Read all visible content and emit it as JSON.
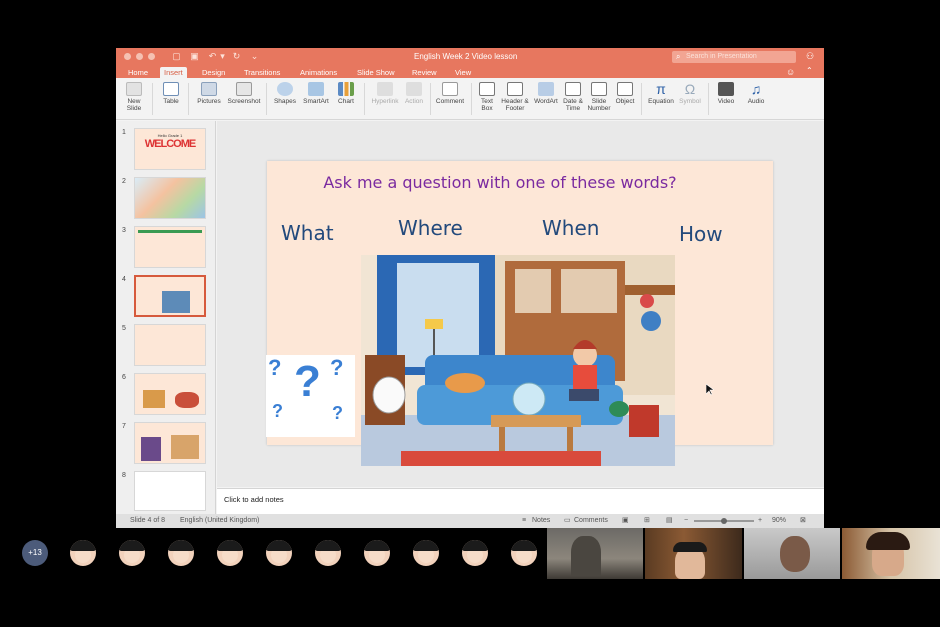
{
  "window": {
    "doc_title": "English Week 2 Video lesson",
    "search_placeholder": "Search in Presentation"
  },
  "tabs": [
    "Home",
    "Insert",
    "Design",
    "Transitions",
    "Animations",
    "Slide Show",
    "Review",
    "View"
  ],
  "active_tab": "Insert",
  "ribbon": {
    "new_slide": "New Slide",
    "table": "Table",
    "pictures": "Pictures",
    "screenshot": "Screenshot",
    "shapes": "Shapes",
    "smartart": "SmartArt",
    "chart": "Chart",
    "hyperlink": "Hyperlink",
    "action": "Action",
    "comment": "Comment",
    "text_box": "Text Box",
    "header_footer": "Header & Footer",
    "wordart": "WordArt",
    "date_time": "Date & Time",
    "slide_number": "Slide Number",
    "object": "Object",
    "equation": "Equation",
    "symbol": "Symbol",
    "video": "Video",
    "audio": "Audio"
  },
  "slide_numbers": [
    "1",
    "2",
    "3",
    "4",
    "5",
    "6",
    "7",
    "8"
  ],
  "selected_slide": 4,
  "thumb1_title": "Hello Grade 1",
  "thumb1_welcome": "WELCOME",
  "slide": {
    "question": "Ask me a question with one of these words?",
    "words": [
      "What",
      "Where",
      "When",
      "How"
    ]
  },
  "notes_placeholder": "Click to add notes",
  "status": {
    "slide_of": "Slide 4 of 8",
    "language": "English (United Kingdom)",
    "notes": "Notes",
    "comments": "Comments",
    "zoom": "90%",
    "zoom_fraction": 0.5
  },
  "participants": {
    "more_count": "+13"
  },
  "colors": {
    "accent": "#e7775f",
    "question_text": "#7a2aa0",
    "word_text": "#234a7c",
    "slide_bg": "#fde7d7"
  }
}
